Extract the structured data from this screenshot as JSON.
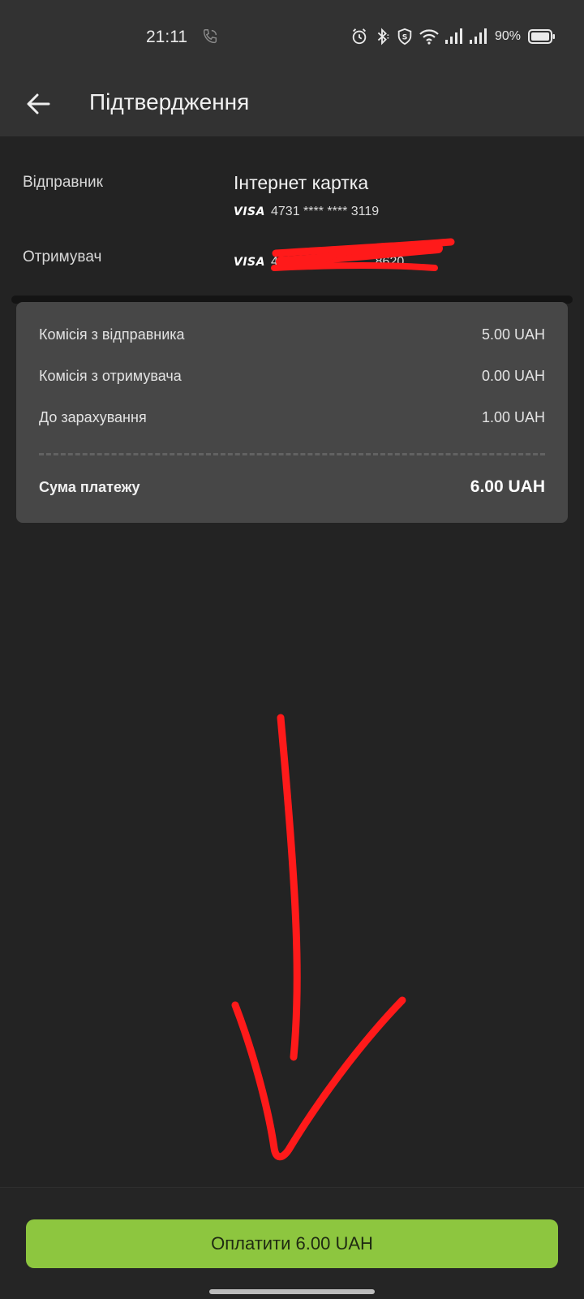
{
  "status_bar": {
    "time": "21:11",
    "battery_percent": "90%",
    "icons": [
      "phone-call-icon",
      "alarm-icon",
      "bluetooth-icon",
      "shield-icon",
      "wifi-icon",
      "signal-icon",
      "signal-icon",
      "battery-icon"
    ]
  },
  "header": {
    "title": "Підтвердження",
    "back_icon": "arrow-left-icon"
  },
  "sender": {
    "label": "Відправник",
    "name": "Інтернет картка",
    "card_brand": "VISA",
    "card_number": "4731 **** **** 3119"
  },
  "recipient": {
    "label": "Отримувач",
    "card_brand": "VISA",
    "card_number": "4441 11",
    "card_number_tail": "8620"
  },
  "fees": {
    "rows": [
      {
        "label": "Комісія з відправника",
        "value": "5.00 UAH"
      },
      {
        "label": "Комісія з отримувача",
        "value": "0.00 UAH"
      },
      {
        "label": "До зарахування",
        "value": "1.00 UAH"
      }
    ],
    "total_label": "Сума платежу",
    "total_value": "6.00 UAH"
  },
  "pay_button": {
    "label": "Оплатити 6.00 UAH",
    "color": "#8dc63f"
  },
  "annotation_color": "#ff1a1a"
}
